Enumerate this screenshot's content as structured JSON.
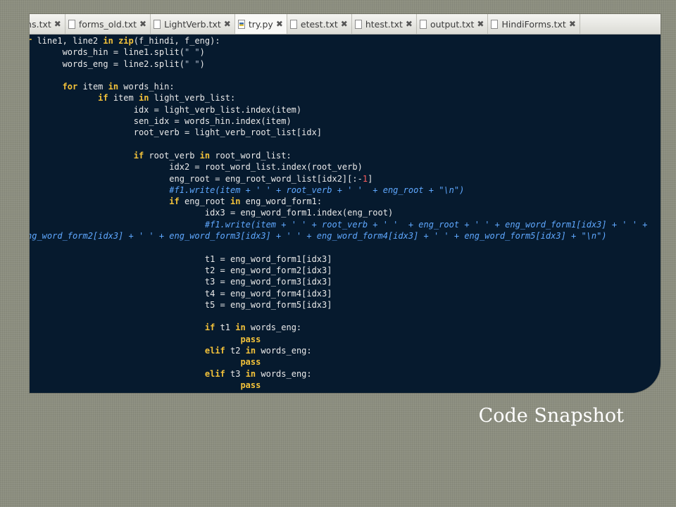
{
  "editor": {
    "tabs": [
      {
        "label": "rms.txt",
        "icon": "file-icon",
        "close": "✖",
        "active": false
      },
      {
        "label": "forms_old.txt",
        "icon": "file-icon",
        "close": "✖",
        "active": false
      },
      {
        "label": "LightVerb.txt",
        "icon": "file-icon",
        "close": "✖",
        "active": false
      },
      {
        "label": "try.py",
        "icon": "python-file-icon",
        "close": "✖",
        "active": true
      },
      {
        "label": "etest.txt",
        "icon": "file-icon",
        "close": "✖",
        "active": false
      },
      {
        "label": "htest.txt",
        "icon": "file-icon",
        "close": "✖",
        "active": false
      },
      {
        "label": "output.txt",
        "icon": "file-icon",
        "close": "✖",
        "active": false
      },
      {
        "label": "HindiForms.txt",
        "icon": "file-icon",
        "close": "✖",
        "active": false
      }
    ],
    "code_lines": [
      [
        [
          "kw",
          "r "
        ],
        [
          "t",
          "line1, line2 "
        ],
        [
          "kw",
          "in"
        ],
        [
          "t",
          " "
        ],
        [
          "kw",
          "zip"
        ],
        [
          "t",
          "(f_hindi, f_eng):"
        ]
      ],
      [
        [
          "t",
          "       words_hin = line1.split("
        ],
        [
          "str",
          "\" \""
        ],
        [
          "t",
          ")"
        ]
      ],
      [
        [
          "t",
          "       words_eng = line2.split("
        ],
        [
          "str",
          "\" \""
        ],
        [
          "t",
          ")"
        ]
      ],
      [],
      [
        [
          "t",
          "       "
        ],
        [
          "kw",
          "for"
        ],
        [
          "t",
          " item "
        ],
        [
          "kw",
          "in"
        ],
        [
          "t",
          " words_hin:"
        ]
      ],
      [
        [
          "t",
          "              "
        ],
        [
          "kw",
          "if"
        ],
        [
          "t",
          " item "
        ],
        [
          "kw",
          "in"
        ],
        [
          "t",
          " light_verb_list:"
        ]
      ],
      [
        [
          "t",
          "                     idx = light_verb_list.index(item)"
        ]
      ],
      [
        [
          "t",
          "                     sen_idx = words_hin.index(item)"
        ]
      ],
      [
        [
          "t",
          "                     root_verb = light_verb_root_list[idx]"
        ]
      ],
      [],
      [
        [
          "t",
          "                     "
        ],
        [
          "kw",
          "if"
        ],
        [
          "t",
          " root_verb "
        ],
        [
          "kw",
          "in"
        ],
        [
          "t",
          " root_word_list:"
        ]
      ],
      [
        [
          "t",
          "                            idx2 = root_word_list.index(root_verb)"
        ]
      ],
      [
        [
          "t",
          "                            eng_root = eng_root_word_list[idx2][:-"
        ],
        [
          "num",
          "1"
        ],
        [
          "t",
          "]"
        ]
      ],
      [
        [
          "t",
          "                            "
        ],
        [
          "cmt",
          "#f1.write(item + ' ' + root_verb + ' '  + eng_root + \"\\n\")"
        ]
      ],
      [
        [
          "t",
          "                            "
        ],
        [
          "kw",
          "if"
        ],
        [
          "t",
          " eng_root "
        ],
        [
          "kw",
          "in"
        ],
        [
          "t",
          " eng_word_form1:"
        ]
      ],
      [
        [
          "t",
          "                                   idx3 = eng_word_form1.index(eng_root)"
        ]
      ],
      [
        [
          "t",
          "                                   "
        ],
        [
          "cmt",
          "#f1.write(item + ' ' + root_verb + ' '  + eng_root + ' ' + eng_word_form1[idx3] + ' ' +"
        ]
      ],
      [
        [
          "cmt",
          "ng_word_form2[idx3] + ' ' + eng_word_form3[idx3] + ' ' + eng_word_form4[idx3] + ' ' + eng_word_form5[idx3] + \"\\n\")"
        ]
      ],
      [],
      [
        [
          "t",
          "                                   t1 = eng_word_form1[idx3]"
        ]
      ],
      [
        [
          "t",
          "                                   t2 = eng_word_form2[idx3]"
        ]
      ],
      [
        [
          "t",
          "                                   t3 = eng_word_form3[idx3]"
        ]
      ],
      [
        [
          "t",
          "                                   t4 = eng_word_form4[idx3]"
        ]
      ],
      [
        [
          "t",
          "                                   t5 = eng_word_form5[idx3]"
        ]
      ],
      [],
      [
        [
          "t",
          "                                   "
        ],
        [
          "kw",
          "if"
        ],
        [
          "t",
          " t1 "
        ],
        [
          "kw",
          "in"
        ],
        [
          "t",
          " words_eng:"
        ]
      ],
      [
        [
          "t",
          "                                          "
        ],
        [
          "kw",
          "pass"
        ]
      ],
      [
        [
          "t",
          "                                   "
        ],
        [
          "kw",
          "elif"
        ],
        [
          "t",
          " t2 "
        ],
        [
          "kw",
          "in"
        ],
        [
          "t",
          " words_eng:"
        ]
      ],
      [
        [
          "t",
          "                                          "
        ],
        [
          "kw",
          "pass"
        ]
      ],
      [
        [
          "t",
          "                                   "
        ],
        [
          "kw",
          "elif"
        ],
        [
          "t",
          " t3 "
        ],
        [
          "kw",
          "in"
        ],
        [
          "t",
          " words_eng:"
        ]
      ],
      [
        [
          "t",
          "                                          "
        ],
        [
          "kw",
          "pass"
        ]
      ]
    ]
  },
  "caption": "Code Snapshot"
}
